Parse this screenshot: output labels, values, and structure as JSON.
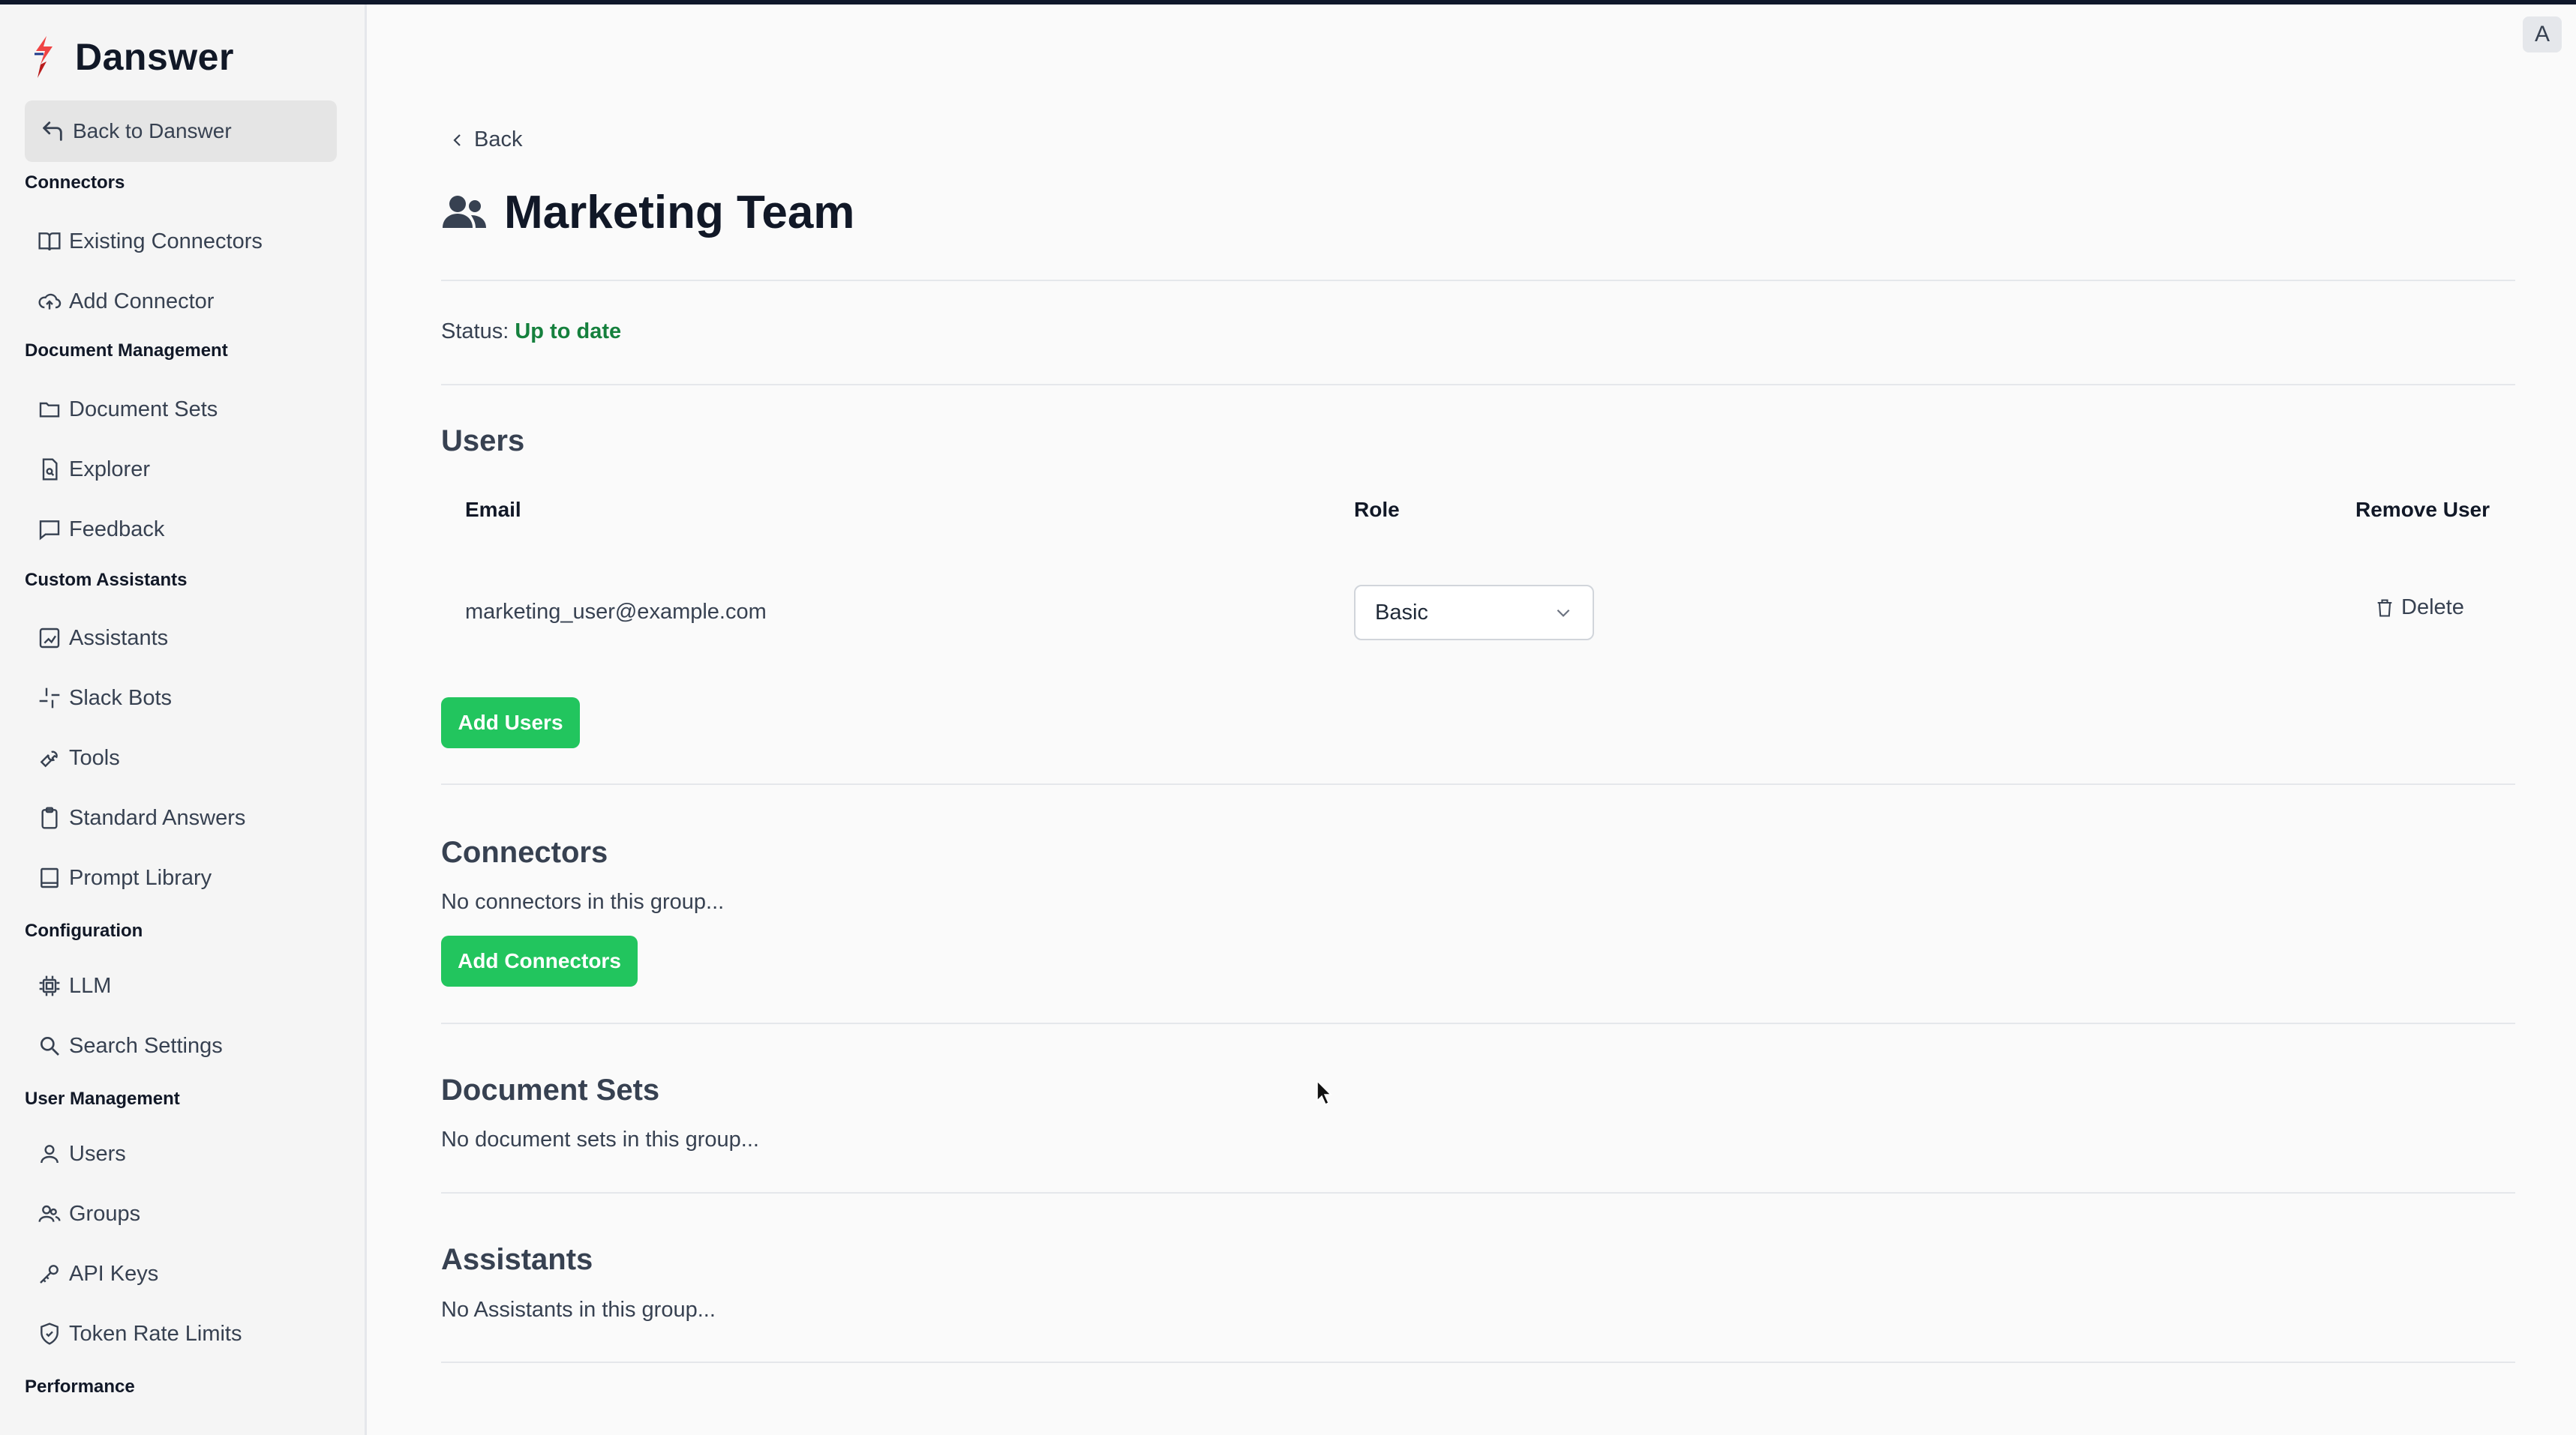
{
  "app": {
    "name": "Danswer",
    "back_label": "Back to Danswer"
  },
  "sidebar": {
    "sections": [
      {
        "title": "Connectors",
        "items": [
          {
            "label": "Existing Connectors",
            "icon": "book-icon"
          },
          {
            "label": "Add Connector",
            "icon": "cloud-upload-icon"
          }
        ]
      },
      {
        "title": "Document Management",
        "items": [
          {
            "label": "Document Sets",
            "icon": "folder-icon"
          },
          {
            "label": "Explorer",
            "icon": "file-search-icon"
          },
          {
            "label": "Feedback",
            "icon": "message-icon"
          }
        ]
      },
      {
        "title": "Custom Assistants",
        "items": [
          {
            "label": "Assistants",
            "icon": "robot-icon"
          },
          {
            "label": "Slack Bots",
            "icon": "slack-icon"
          },
          {
            "label": "Tools",
            "icon": "wrench-icon"
          },
          {
            "label": "Standard Answers",
            "icon": "clipboard-icon"
          },
          {
            "label": "Prompt Library",
            "icon": "notebook-icon"
          }
        ]
      },
      {
        "title": "Configuration",
        "items": [
          {
            "label": "LLM",
            "icon": "cpu-icon"
          },
          {
            "label": "Search Settings",
            "icon": "search-icon"
          }
        ]
      },
      {
        "title": "User Management",
        "items": [
          {
            "label": "Users",
            "icon": "user-icon"
          },
          {
            "label": "Groups",
            "icon": "users-icon"
          },
          {
            "label": "API Keys",
            "icon": "key-icon"
          },
          {
            "label": "Token Rate Limits",
            "icon": "shield-icon"
          }
        ]
      },
      {
        "title": "Performance",
        "items": []
      }
    ]
  },
  "header": {
    "avatar_letter": "A"
  },
  "main": {
    "back_label": "Back",
    "title": "Marketing Team",
    "status_label": "Status:",
    "status_value": "Up to date",
    "users": {
      "heading": "Users",
      "columns": [
        "Email",
        "Role",
        "Remove User"
      ],
      "rows": [
        {
          "email": "marketing_user@example.com",
          "role": "Basic",
          "action": "Delete"
        }
      ],
      "add_button": "Add Users"
    },
    "connectors": {
      "heading": "Connectors",
      "empty_text": "No connectors in this group...",
      "add_button": "Add Connectors"
    },
    "document_sets": {
      "heading": "Document Sets",
      "empty_text": "No document sets in this group..."
    },
    "assistants": {
      "heading": "Assistants",
      "empty_text": "No Assistants in this group..."
    }
  },
  "colors": {
    "accent_green": "#22c55e",
    "status_green": "#15803d"
  }
}
